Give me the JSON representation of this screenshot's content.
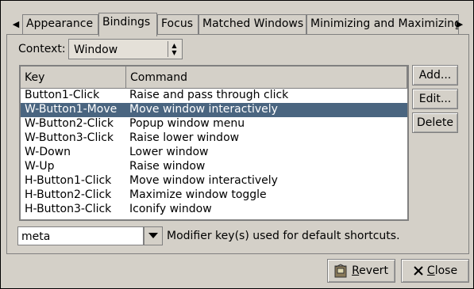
{
  "tabs": [
    {
      "label": "Appearance"
    },
    {
      "label": "Bindings"
    },
    {
      "label": "Focus"
    },
    {
      "label": "Matched Windows"
    },
    {
      "label": "Minimizing and Maximizing"
    }
  ],
  "active_tab": "Bindings",
  "context": {
    "label": "Context:",
    "value": "Window"
  },
  "table": {
    "columns": [
      "Key",
      "Command"
    ],
    "rows": [
      {
        "key": "Button1-Click",
        "command": "Raise and pass through click"
      },
      {
        "key": "W-Button1-Move",
        "command": "Move window interactively"
      },
      {
        "key": "W-Button2-Click",
        "command": "Popup window menu"
      },
      {
        "key": "W-Button3-Click",
        "command": "Raise lower window"
      },
      {
        "key": "W-Down",
        "command": "Lower window"
      },
      {
        "key": "W-Up",
        "command": "Raise window"
      },
      {
        "key": "H-Button1-Click",
        "command": "Move window interactively"
      },
      {
        "key": "H-Button2-Click",
        "command": "Maximize window toggle"
      },
      {
        "key": "H-Button3-Click",
        "command": "Iconify window"
      }
    ],
    "selected_row": 1
  },
  "buttons": {
    "add": "Add...",
    "edit": "Edit...",
    "delete": "Delete"
  },
  "modifier": {
    "value": "meta",
    "description": "Modifier key(s) used for default shortcuts."
  },
  "footer": {
    "revert_first": "R",
    "revert_rest": "evert",
    "close_first": "C",
    "close_rest": "lose"
  },
  "colors": {
    "selection": "#4a6580",
    "background": "#d4d0c8"
  }
}
